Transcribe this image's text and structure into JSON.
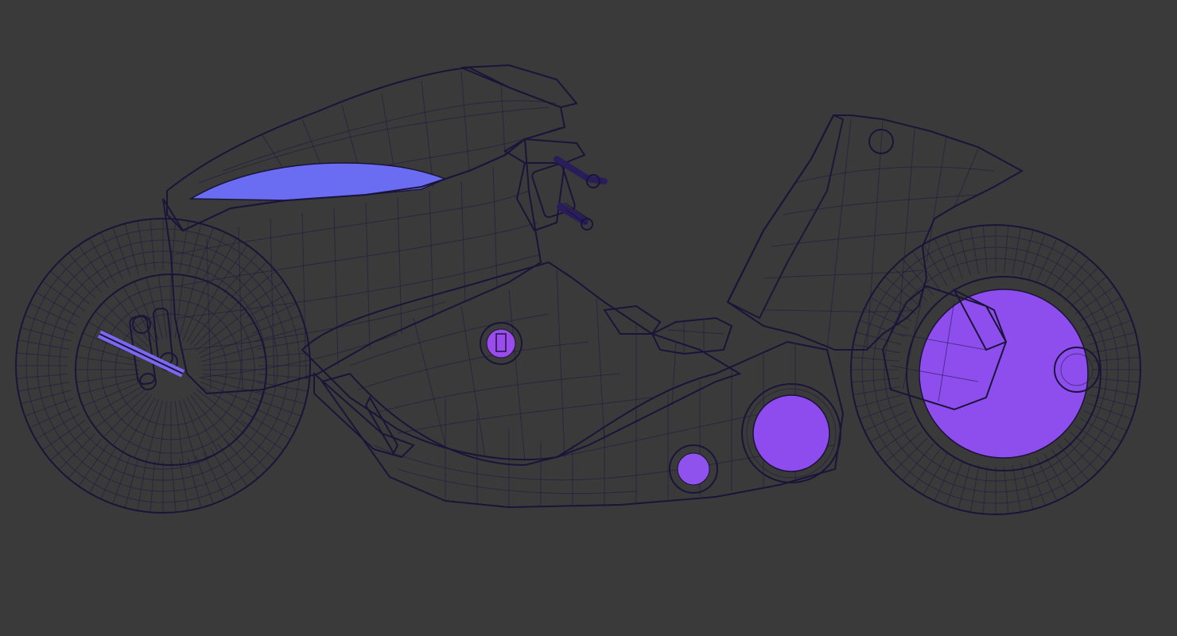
{
  "viewport": {
    "background": "#3a3a3a",
    "shading": "normal-map"
  },
  "palette": {
    "cyan": "#3fd6d0",
    "green": "#5fe08c",
    "blue": "#5a73f0",
    "violet": "#8a4cf0",
    "magenta": "#d34fd6",
    "wire": "#1c1640"
  },
  "model": {
    "name": "motorcycle",
    "display": "wireframe-over-normals",
    "parts": [
      "rear-wheel",
      "front-wheel",
      "rear-cowl",
      "seat",
      "body-shell",
      "front-fairing",
      "swingarm",
      "fuel-cap",
      "handlebar",
      "fork-block"
    ]
  }
}
